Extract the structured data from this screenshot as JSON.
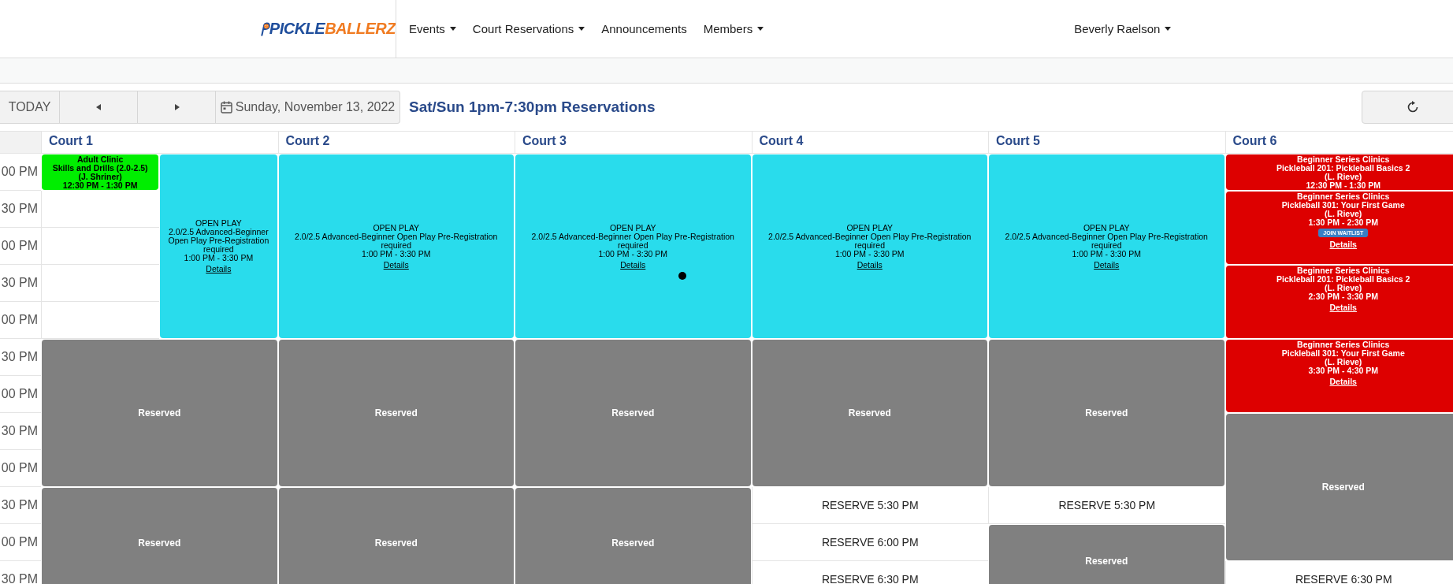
{
  "logo": {
    "part_1": "PICKLE",
    "part_2": "BALLERZ"
  },
  "nav": [
    {
      "label": "Events",
      "dropdown": true
    },
    {
      "label": "Court Reservations",
      "dropdown": true
    },
    {
      "label": "Announcements",
      "dropdown": false
    },
    {
      "label": "Members",
      "dropdown": true
    }
  ],
  "user": {
    "name": "Beverly Raelson"
  },
  "toolbar": {
    "today": "TODAY",
    "date": "Sunday, November 13, 2022",
    "title": "Sat/Sun 1pm-7:30pm Reservations"
  },
  "times": [
    "00 PM",
    "30 PM",
    "00 PM",
    "30 PM",
    "00 PM",
    "30 PM",
    "00 PM",
    "30 PM",
    "00 PM",
    "30 PM",
    "00 PM",
    "30 PM"
  ],
  "courts": [
    {
      "name": "Court 1",
      "blocks": [
        {
          "kind": "event",
          "color": "#00ee00",
          "lines": [
            "Adult Clinic",
            "Skills and Drills (2.0-2.5)",
            "(J. Shriner)",
            "12:30 PM - 1:30 PM"
          ]
        },
        {
          "kind": "event",
          "color": "#29dcec",
          "lines": [
            "OPEN PLAY",
            "2.0/2.5 Advanced-Beginner Open Play Pre-Registration required",
            "1:00 PM - 3:30 PM"
          ],
          "link": "Details"
        },
        {
          "kind": "reserved",
          "label": "Reserved"
        },
        {
          "kind": "reserved",
          "label": "Reserved"
        }
      ]
    },
    {
      "name": "Court 2",
      "blocks": [
        {
          "kind": "event",
          "color": "#29dcec",
          "lines": [
            "OPEN PLAY",
            "2.0/2.5 Advanced-Beginner Open Play Pre-Registration required",
            "1:00 PM - 3:30 PM"
          ],
          "link": "Details"
        },
        {
          "kind": "reserved",
          "label": "Reserved"
        },
        {
          "kind": "reserved",
          "label": "Reserved"
        }
      ]
    },
    {
      "name": "Court 3",
      "blocks": [
        {
          "kind": "event",
          "color": "#29dcec",
          "lines": [
            "OPEN PLAY",
            "2.0/2.5 Advanced-Beginner Open Play Pre-Registration required",
            "1:00 PM - 3:30 PM"
          ],
          "link": "Details"
        },
        {
          "kind": "reserved",
          "label": "Reserved"
        },
        {
          "kind": "reserved",
          "label": "Reserved"
        }
      ]
    },
    {
      "name": "Court 4",
      "blocks": [
        {
          "kind": "event",
          "color": "#29dcec",
          "lines": [
            "OPEN PLAY",
            "2.0/2.5 Advanced-Beginner Open Play Pre-Registration required",
            "1:00 PM - 3:30 PM"
          ],
          "link": "Details"
        },
        {
          "kind": "reserved",
          "label": "Reserved"
        },
        {
          "kind": "reserve",
          "label": "RESERVE 5:30 PM"
        },
        {
          "kind": "reserve",
          "label": "RESERVE 6:00 PM"
        },
        {
          "kind": "reserve",
          "label": "RESERVE 6:30 PM"
        }
      ]
    },
    {
      "name": "Court 5",
      "blocks": [
        {
          "kind": "event",
          "color": "#29dcec",
          "lines": [
            "OPEN PLAY",
            "2.0/2.5 Advanced-Beginner Open Play Pre-Registration required",
            "1:00 PM - 3:30 PM"
          ],
          "link": "Details"
        },
        {
          "kind": "reserved",
          "label": "Reserved"
        },
        {
          "kind": "reserve",
          "label": "RESERVE 5:30 PM"
        },
        {
          "kind": "reserved",
          "label": "Reserved"
        }
      ]
    },
    {
      "name": "Court 6",
      "blocks": [
        {
          "kind": "event",
          "color": "#dd0000",
          "lines": [
            "Beginner Series Clinics",
            "Pickleball 201: Pickleball Basics 2",
            "(L. Rieve)",
            "12:30 PM - 1:30 PM"
          ]
        },
        {
          "kind": "event",
          "color": "#dd0000",
          "lines": [
            "Beginner Series Clinics",
            "Pickleball 301: Your First Game",
            "(L. Rieve)",
            "1:30 PM - 2:30 PM"
          ],
          "button": "JOIN WAITLIST",
          "link": "Details"
        },
        {
          "kind": "event",
          "color": "#dd0000",
          "lines": [
            "Beginner Series Clinics",
            "Pickleball 201: Pickleball Basics 2",
            "(L. Rieve)",
            "2:30 PM - 3:30 PM"
          ],
          "link": "Details"
        },
        {
          "kind": "event",
          "color": "#dd0000",
          "lines": [
            "Beginner Series Clinics",
            "Pickleball 301: Your First Game",
            "(L. Rieve)",
            "3:30 PM - 4:30 PM"
          ],
          "link": "Details"
        },
        {
          "kind": "reserved",
          "label": "Reserved"
        },
        {
          "kind": "reserve",
          "label": "RESERVE 6:30 PM"
        }
      ]
    }
  ]
}
